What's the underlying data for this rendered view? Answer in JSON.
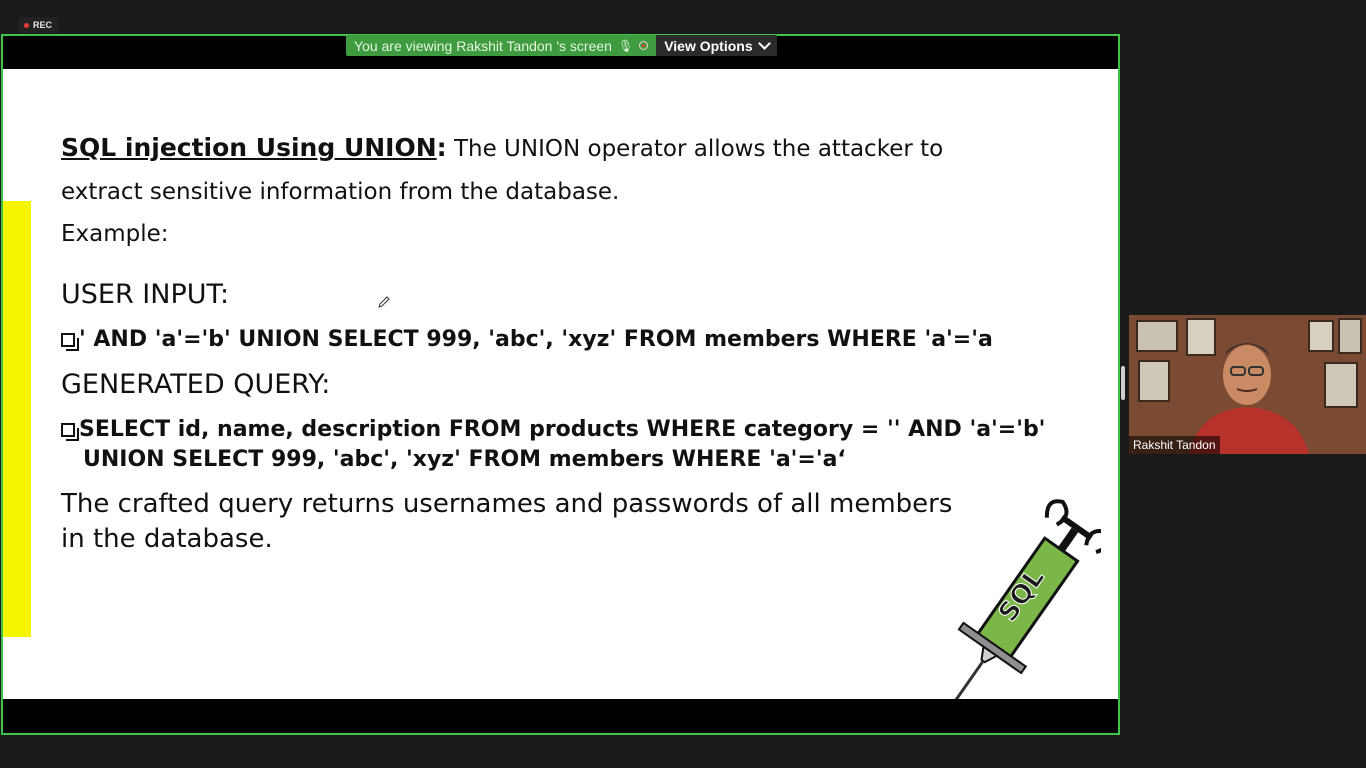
{
  "recording": {
    "label": "REC"
  },
  "share_banner": {
    "text": "You are viewing Rakshit Tandon 's screen",
    "view_options_label": "View Options"
  },
  "slide": {
    "heading": "SQL injection Using UNION",
    "heading_colon": ":",
    "intro_rest": " The UNION operator allows the attacker to",
    "intro_line2": "extract sensitive information from the database.",
    "example_label": "Example:",
    "user_input_label": "USER INPUT:",
    "user_input_value": "' AND 'a'='b' UNION SELECT 999, 'abc', 'xyz' FROM members WHERE 'a'='a",
    "generated_query_label": "GENERATED QUERY:",
    "generated_query_line1": "SELECT id, name, description FROM products WHERE category = '' AND 'a'='b'",
    "generated_query_line2": "UNION SELECT 999, 'abc', 'xyz' FROM members WHERE 'a'='a‘",
    "conclusion_line1": "The crafted query returns usernames and passwords of all members",
    "conclusion_line2": "in the database.",
    "syringe_label": "SQL"
  },
  "participant": {
    "name": "Rakshit Tandon"
  },
  "colors": {
    "share_border": "#3fc44a",
    "banner_bg": "#3e9b3f",
    "highlight_bar": "#f5f500",
    "syringe_liquid": "#7ab648"
  }
}
